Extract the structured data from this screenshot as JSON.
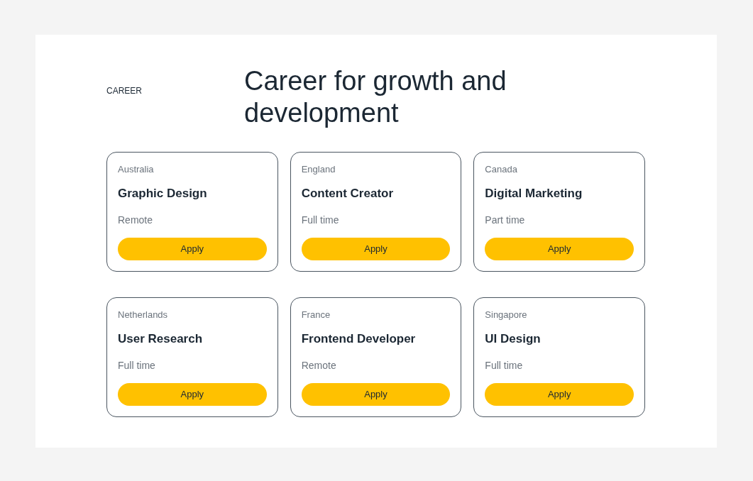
{
  "section_label": "CAREER",
  "heading": "Career for growth and development",
  "jobs": [
    {
      "location": "Australia",
      "title": "Graphic Design",
      "type": "Remote",
      "button": "Apply"
    },
    {
      "location": "England",
      "title": "Content Creator",
      "type": "Full time",
      "button": "Apply"
    },
    {
      "location": "Canada",
      "title": "Digital Marketing",
      "type": "Part time",
      "button": "Apply"
    },
    {
      "location": "Netherlands",
      "title": "User Research",
      "type": "Full time",
      "button": "Apply"
    },
    {
      "location": "France",
      "title": "Frontend Developer",
      "type": "Remote",
      "button": "Apply"
    },
    {
      "location": "Singapore",
      "title": "UI Design",
      "type": "Full time",
      "button": "Apply"
    }
  ]
}
